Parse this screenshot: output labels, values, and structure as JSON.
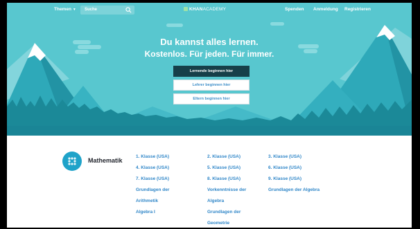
{
  "nav": {
    "themen": "Themen",
    "search_placeholder": "Suche",
    "logo_bold": "KHAN",
    "logo_rest": "ACADEMY",
    "spenden": "Spenden",
    "anmeldung": "Anmeldung",
    "registrieren": "Registrieren"
  },
  "hero": {
    "line1": "Du kannst alles lernen.",
    "line2": "Kostenlos. Für jeden. Für immer.",
    "btn_learner": "Lernende beginnen hier",
    "btn_teacher": "Lehrer beginnen hier",
    "btn_parent": "Eltern beginnen hier"
  },
  "subject": {
    "title": "Mathematik",
    "links": [
      "1. Klasse (USA)",
      "2. Klasse (USA)",
      "3. Klasse (USA)",
      "4. Klasse (USA)",
      "5. Klasse (USA)",
      "6. Klasse (USA)",
      "7. Klasse (USA)",
      "8. Klasse (USA)",
      "9. Klasse (USA)",
      "Grundlagen der",
      "Vorkenntnisse der",
      "Grundlagen der Algebra",
      "Arithmetik",
      "Algebra",
      "Algebra I",
      "Grundlagen der",
      "Geometrie"
    ]
  },
  "colors": {
    "sky": "#58c7cf",
    "button_dark": "#163f49",
    "link": "#2f86c8",
    "subject_icon": "#1fa3c9"
  },
  "icons": {
    "search": "search-icon",
    "logo": "khan-leaf-icon",
    "subject": "math-dots-icon"
  }
}
